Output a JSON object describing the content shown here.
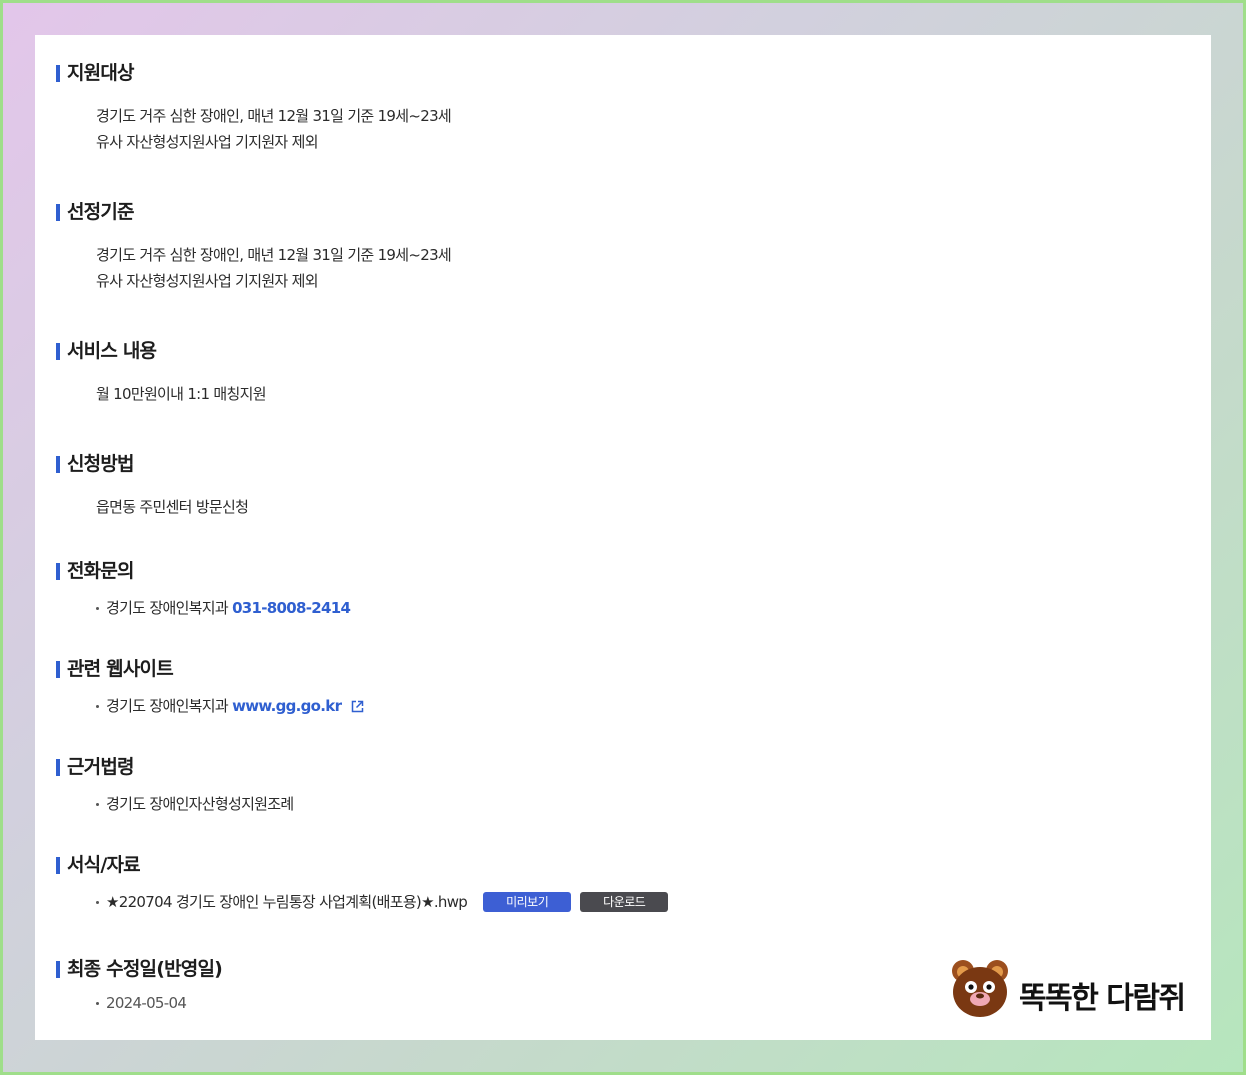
{
  "sections": {
    "target": {
      "title": "지원대상",
      "lines": [
        "경기도 거주 심한 장애인, 매년 12월 31일 기준 19세~23세",
        "유사 자산형성지원사업 기지원자 제외"
      ]
    },
    "criteria": {
      "title": "선정기준",
      "lines": [
        "경기도 거주 심한 장애인, 매년 12월 31일 기준 19세~23세",
        "유사 자산형성지원사업 기지원자 제외"
      ]
    },
    "service": {
      "title": "서비스 내용",
      "lines": [
        "월 10만원이내 1:1 매칭지원"
      ]
    },
    "apply": {
      "title": "신청방법",
      "lines": [
        "읍면동 주민센터 방문신청"
      ]
    },
    "phone": {
      "title": "전화문의",
      "org": "경기도 장애인복지과",
      "number": "031-8008-2414"
    },
    "website": {
      "title": "관련 웹사이트",
      "org": "경기도 장애인복지과",
      "url": "www.gg.go.kr"
    },
    "law": {
      "title": "근거법령",
      "text": "경기도 장애인자산형성지원조례"
    },
    "forms": {
      "title": "서식/자료",
      "file": "★220704 경기도 장애인 누림통장 사업계획(배포용)★.hwp",
      "preview_label": "미리보기",
      "download_label": "다운로드"
    },
    "updated": {
      "title": "최종 수정일(반영일)",
      "date": "2024-05-04"
    }
  },
  "logo": {
    "text": "똑똑한 다람쥐",
    "icon": "squirrel-face-icon"
  },
  "colors": {
    "accent": "#2f5fd0",
    "preview_button": "#3d5fd4",
    "download_button": "#4a4a4f"
  }
}
